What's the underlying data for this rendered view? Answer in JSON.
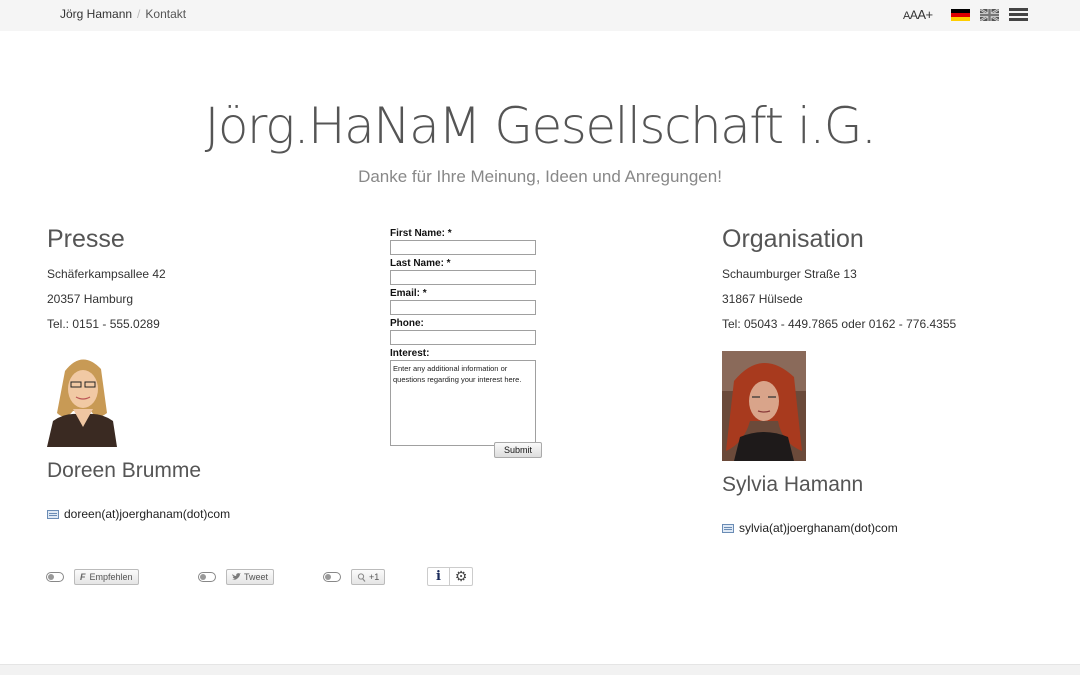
{
  "breadcrumb": {
    "home": "Jörg Hamann",
    "separator": "/",
    "current": "Kontakt"
  },
  "font_size_control": {
    "a1": "A",
    "a2": "A",
    "a3": "A+"
  },
  "header": {
    "title": "Jörg.HaNaM Gesellschaft i.G.",
    "subtitle": "Danke für Ihre Meinung, Ideen und Anregungen!"
  },
  "press": {
    "heading": "Presse",
    "street": "Schäferkampsallee 42",
    "city": "20357 Hamburg",
    "phone": "Tel.: 0151 - 555.0289",
    "name": "Doreen Brumme",
    "email": "doreen(at)joerghanam(dot)com"
  },
  "organisation": {
    "heading": "Organisation",
    "street": "Schaumburger Straße 13",
    "city": "31867 Hülsede",
    "phone": "Tel: 05043 - 449.7865 oder 0162 - 776.4355",
    "name": "Sylvia Hamann",
    "email": "sylvia(at)joerghanam(dot)com"
  },
  "form": {
    "first_name_label": "First Name: *",
    "last_name_label": "Last Name: *",
    "email_label": "Email: *",
    "phone_label": "Phone:",
    "interest_label": "Interest:",
    "interest_value": "Enter any additional information or questions regarding your interest here.",
    "submit_label": "Submit"
  },
  "social": {
    "facebook_glyph": "F",
    "facebook_label": "Empfehlen",
    "twitter_label": "Tweet",
    "gplus_label": "+1"
  },
  "colors": {
    "accent_text": "#555555",
    "topbar_bg": "#f5f5f5"
  },
  "icons": [
    "flag-de-icon",
    "flag-en-icon",
    "menu-icon",
    "mail-icon",
    "info-icon",
    "gear-icon",
    "toggle-icon"
  ]
}
